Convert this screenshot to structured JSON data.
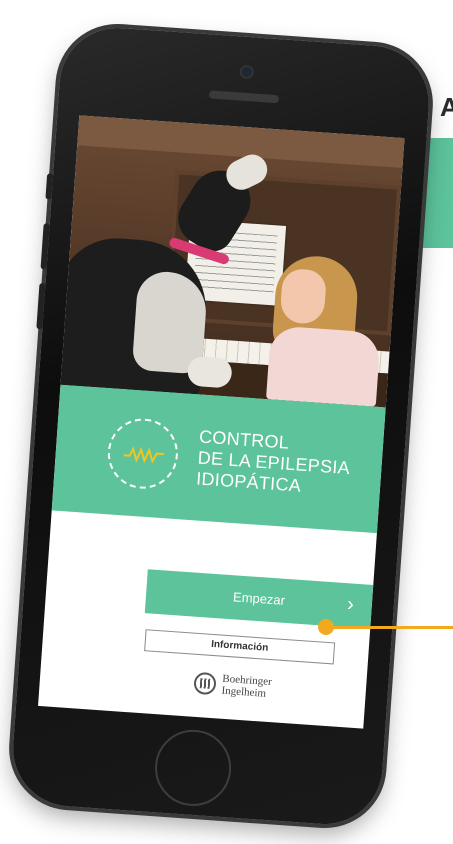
{
  "background": {
    "fragment_letter": "A",
    "accent_color": "#5cc39b",
    "callout_color": "#f3a91f"
  },
  "app": {
    "title_lines": [
      "CONTROL",
      "DE LA EPILEPSIA",
      "IDIOPÁTICA"
    ],
    "logo_icon": "brain-wave-clock-icon",
    "hero_image": "dog-and-girl-singing-at-piano"
  },
  "actions": {
    "start_label": "Empezar",
    "start_icon": "chevron-right-icon",
    "info_label": "Información"
  },
  "footer": {
    "company_line1": "Boehringer",
    "company_line2": "Ingelheim"
  }
}
